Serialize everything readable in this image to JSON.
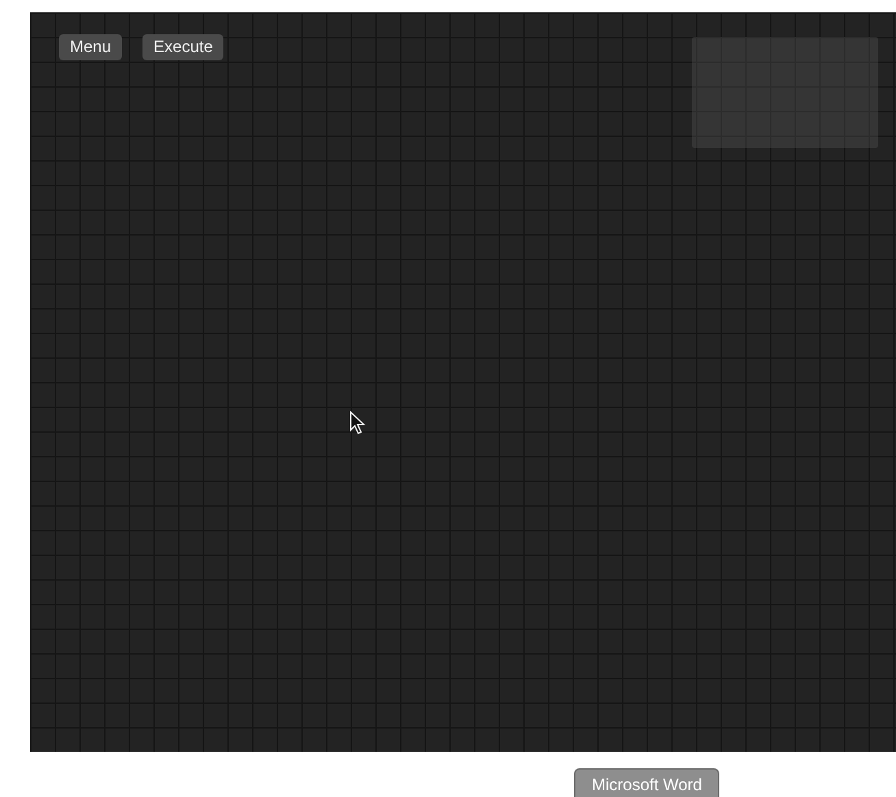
{
  "toolbar": {
    "buttons": [
      {
        "label": "Menu"
      },
      {
        "label": "Execute"
      }
    ]
  },
  "tooltip": {
    "label": "Microsoft Word"
  }
}
